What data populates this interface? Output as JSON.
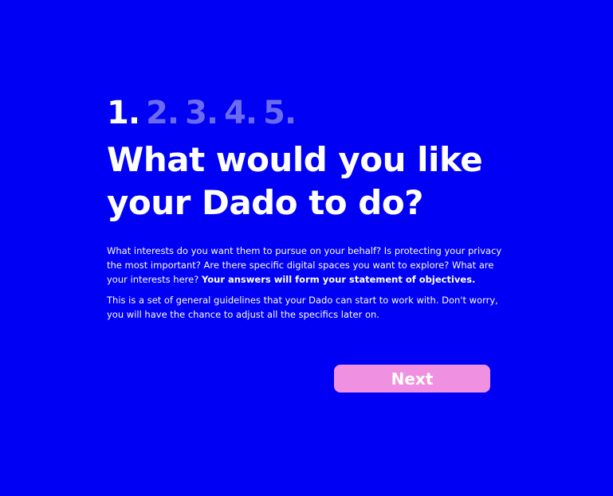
{
  "steps": [
    {
      "label": "1.",
      "active": true
    },
    {
      "label": "2.",
      "active": false
    },
    {
      "label": "3.",
      "active": false
    },
    {
      "label": "4.",
      "active": false
    },
    {
      "label": "5.",
      "active": false
    }
  ],
  "title": "What would you like your Dado to do?",
  "paragraph1": {
    "text": "What interests do you want them to pursue on your behalf? Is protecting your privacy the most important? Are there specific digital spaces you want to explore? What are your interests here? ",
    "emphasis": "Your answers will form your statement of objectives."
  },
  "paragraph2": "This is a set of general guidelines that your Dado can start to work with. Don't worry, you will have the chance to adjust all the specifics later on.",
  "next_button": {
    "label": "Next"
  },
  "colors": {
    "background": "#0000f5",
    "text": "#ffffff",
    "inactive_step": "#6b6bef",
    "button": "#f090e0"
  }
}
